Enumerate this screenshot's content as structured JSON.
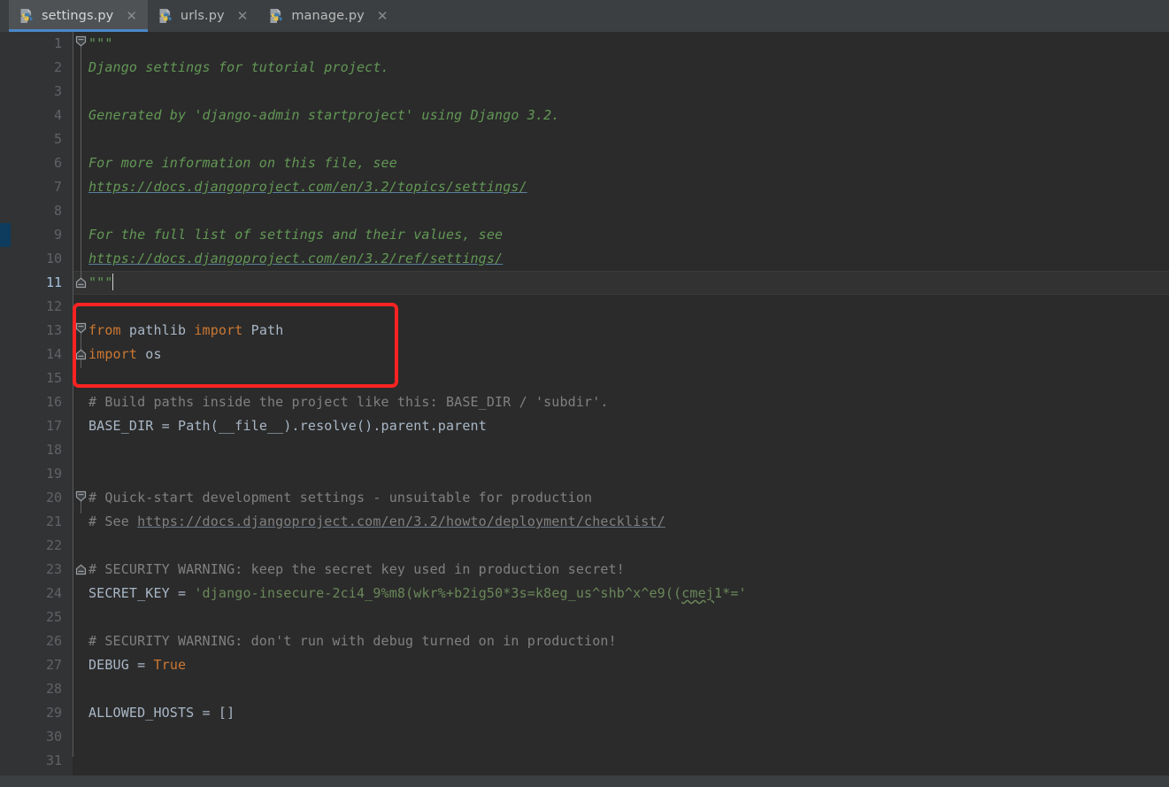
{
  "window": {
    "title": "settings.py",
    "theme": "darcula"
  },
  "tabs": [
    {
      "label": "settings.py",
      "icon": "python-file-icon",
      "close_icon": "close-icon",
      "active": true
    },
    {
      "label": "urls.py",
      "icon": "python-file-icon",
      "close_icon": "close-icon",
      "active": false
    },
    {
      "label": "manage.py",
      "icon": "python-file-icon",
      "close_icon": "close-icon",
      "active": false
    }
  ],
  "colors": {
    "tabbar_bg": "#3c3f41",
    "active_tab_bg": "#4e5254",
    "active_tab_underline": "#4a88c7",
    "editor_bg": "#2b2b2b",
    "gutter_bg": "#313335",
    "current_line_bg": "#323232",
    "docstring_green": "#629755",
    "string_green": "#6a8759",
    "comment_gray": "#808080",
    "keyword_orange": "#cc7832",
    "identifier": "#a9b7c6",
    "annotation_red": "#fb2322",
    "vcs_change_blue": "#0d3c5e"
  },
  "editor": {
    "current_line": 11,
    "first_visible_line": 1,
    "last_visible_line": 31,
    "vcs_change_line": 9,
    "line_numbers": [
      "1",
      "2",
      "3",
      "4",
      "5",
      "6",
      "7",
      "8",
      "9",
      "10",
      "11",
      "12",
      "13",
      "14",
      "15",
      "16",
      "17",
      "18",
      "19",
      "20",
      "21",
      "22",
      "23",
      "24",
      "25",
      "26",
      "27",
      "28",
      "29",
      "30",
      "31"
    ]
  },
  "code": {
    "l1_docstring_open": "\"\"\"",
    "l2": "Django settings for tutorial project.",
    "l4": "Generated by 'django-admin startproject' using Django 3.2.",
    "l6": "For more information on this file, see",
    "l7_url": "https://docs.djangoproject.com/en/3.2/topics/settings/",
    "l9": "For the full list of settings and their values, see",
    "l10_url": "https://docs.djangoproject.com/en/3.2/ref/settings/",
    "l11_docstring_close": "\"\"\"",
    "l13_kw_from": "from",
    "l13_module": "pathlib",
    "l13_kw_import": "import",
    "l13_name": "Path",
    "l14_kw_import": "import",
    "l14_module": "os",
    "l16_comment": "# Build paths inside the project like this: BASE_DIR / 'subdir'.",
    "l17_name": "BASE_DIR",
    "l17_eq": "=",
    "l17_expr": "Path(__file__).resolve().parent.parent",
    "l20_comment": "# Quick-start development settings - unsuitable for production",
    "l21_comment_prefix": "# See ",
    "l21_comment_url": "https://docs.djangoproject.com/en/3.2/howto/deployment/checklist/",
    "l23_comment": "# SECURITY WARNING: keep the secret key used in production secret!",
    "l24_name": "SECRET_KEY",
    "l24_eq": "=",
    "l24_value_a": "'django-inse",
    "l24_value_b": "cure-2ci4_9%m8(wkr%+b2ig50*3s=k8eg_us^shb^x^e9((",
    "l24_value_typo": "cmej",
    "l24_value_c": "1*='",
    "l26_comment": "# SECURITY WARNING: don't run with debug turned on in production!",
    "l27_name": "DEBUG",
    "l27_eq": "=",
    "l27_value": "True",
    "l29_name": "ALLOWED_HOSTS",
    "l29_eq": "=",
    "l29_value": "[]"
  },
  "annotation": {
    "shape": "rectangle",
    "color": "#fb2322",
    "covers_lines": "13-14",
    "note": "highlighted import statements"
  }
}
